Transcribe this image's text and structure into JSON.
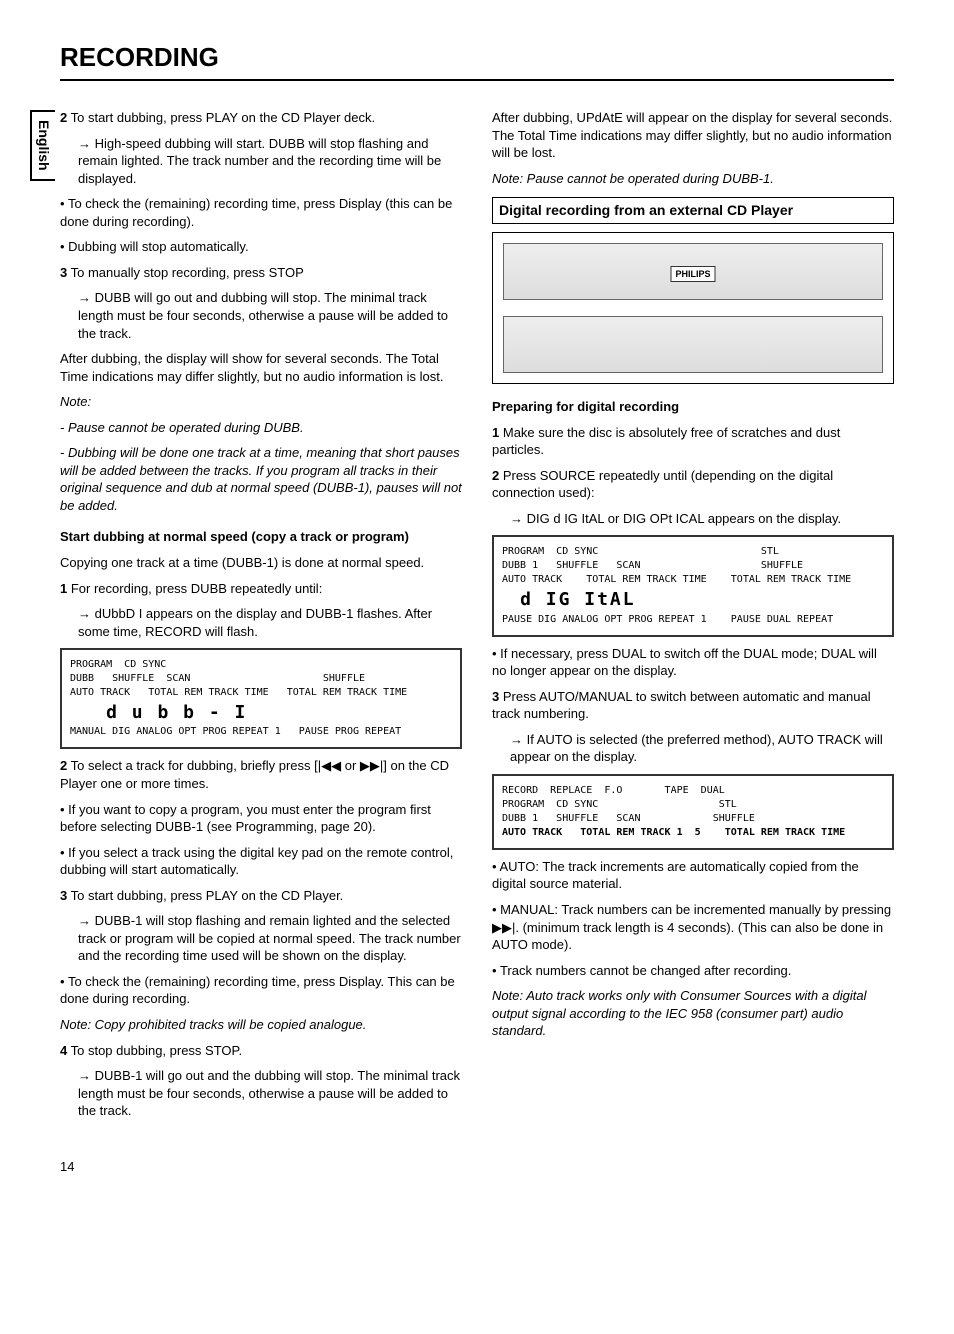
{
  "title": "RECORDING",
  "lang_tab": "English",
  "page_num": "14",
  "col1": {
    "s2": "2",
    "s2_text": "To start dubbing, press PLAY on the CD Player deck.",
    "s2_a1": "High-speed dubbing will start. DUBB will stop flashing and remain lighted. The track number and the recording time will be displayed.",
    "b1": "To check the (remaining) recording time, press Display (this can be done during recording).",
    "b2": "Dubbing will stop automatically.",
    "s3": "3",
    "s3_text": "To manually stop recording, press STOP",
    "s3_a1": "DUBB will go out and dubbing will stop. The minimal track length must be four seconds, otherwise a pause will be added to the track.",
    "after": "After dubbing, the display will show for several seconds. The Total Time indications may differ slightly, but no audio information is lost.",
    "note_h": "Note:",
    "note1": "Pause cannot be operated during DUBB.",
    "note2": "Dubbing will be done one track at a time, meaning that short pauses will be added between the tracks. If you program all tracks in their original sequence and dub at normal speed (DUBB-1), pauses will not be added.",
    "sec_h": "Start dubbing at normal speed (copy a track or program)",
    "copy_one": "Copying one track at a time (DUBB-1) is done at normal speed.",
    "r1": "1",
    "r1_text": "For recording, press DUBB repeatedly until:",
    "r1_a": "dUbbD I appears on the display and DUBB-1 flashes. After some time, RECORD will flash.",
    "disp1_l1": "PROGRAM  CD SYNC",
    "disp1_l2": "DUBB   SHUFFLE  SCAN                      SHUFFLE",
    "disp1_l3": "AUTO TRACK   TOTAL REM TRACK TIME   TOTAL REM TRACK TIME",
    "disp1_seg": "d u b b - I",
    "disp1_l4": "MANUAL DIG ANALOG OPT PROG REPEAT 1   PAUSE PROG REPEAT",
    "r2": "2",
    "r2_text": "To select a track for dubbing, briefly press [|◀◀ or ▶▶|] on the CD Player one or more times.",
    "b3": "If you want to copy a program, you must enter the program first before selecting DUBB-1 (see Programming, page 20).",
    "b4": "If you select a track using the digital key pad on the remote control, dubbing will start automatically.",
    "r3": "3",
    "r3_text": "To start dubbing, press PLAY on the CD Player.",
    "r3_a": "DUBB-1 will stop flashing and remain lighted and the selected track or program will be copied at normal speed. The track number and the recording time used will be shown on the display.",
    "b5": "To check the (remaining) recording time, press Display. This can be done during recording.",
    "note3": "Note: Copy prohibited tracks will be copied analogue.",
    "r4": "4",
    "r4_text": "To stop dubbing, press STOP.",
    "r4_a": "DUBB-1 will go out and the dubbing will stop. The minimal track length must be four seconds, otherwise a pause will be added to the track."
  },
  "col2": {
    "after2": "After dubbing, UPdAtE will appear on the display for several seconds. The Total Time indications may differ slightly, but no audio information will be lost.",
    "note4": "Note: Pause cannot be operated during DUBB-1.",
    "box_h": "Digital recording from an external CD Player",
    "device_label": "PHILIPS",
    "prep_h": "Preparing for digital recording",
    "p1": "1",
    "p1_text": "Make sure the disc is absolutely free of scratches and dust particles.",
    "p2": "2",
    "p2_text": "Press SOURCE repeatedly until (depending on the digital connection used):",
    "p2_a": "DIG d IG ItAL or DIG OPt ICAL appears on the display.",
    "disp2_l1": "PROGRAM  CD SYNC                           STL",
    "disp2_l2": "DUBB 1   SHUFFLE   SCAN                    SHUFFLE",
    "disp2_l3": "AUTO TRACK    TOTAL REM TRACK TIME    TOTAL REM TRACK TIME",
    "disp2_seg": "d IG ItAL",
    "disp2_l4": "PAUSE DIG ANALOG OPT PROG REPEAT 1    PAUSE DUAL REPEAT",
    "b6": "If necessary, press DUAL to switch off the DUAL mode; DUAL will no longer appear on the display.",
    "p3": "3",
    "p3_text": "Press AUTO/MANUAL to switch between automatic and manual track numbering.",
    "p3_a": "If AUTO is selected (the preferred method), AUTO TRACK will appear on the display.",
    "disp3_l1": "RECORD  REPLACE  F.O       TAPE  DUAL",
    "disp3_l2": "PROGRAM  CD SYNC                    STL",
    "disp3_l3": "DUBB 1   SHUFFLE   SCAN            SHUFFLE",
    "disp3_l4": "AUTO TRACK   TOTAL REM TRACK 1  5    TOTAL REM TRACK TIME",
    "b7": "AUTO:   The track increments are automatically copied from the digital source material.",
    "b8": "MANUAL: Track numbers can be incremented manually by pressing ▶▶|. (minimum track length is 4 seconds). (This can also be done in AUTO mode).",
    "b9": "Track numbers cannot be changed after recording.",
    "note5": "Note: Auto track works only with Consumer Sources with a digital output signal according to the IEC 958 (consumer part) audio standard."
  }
}
